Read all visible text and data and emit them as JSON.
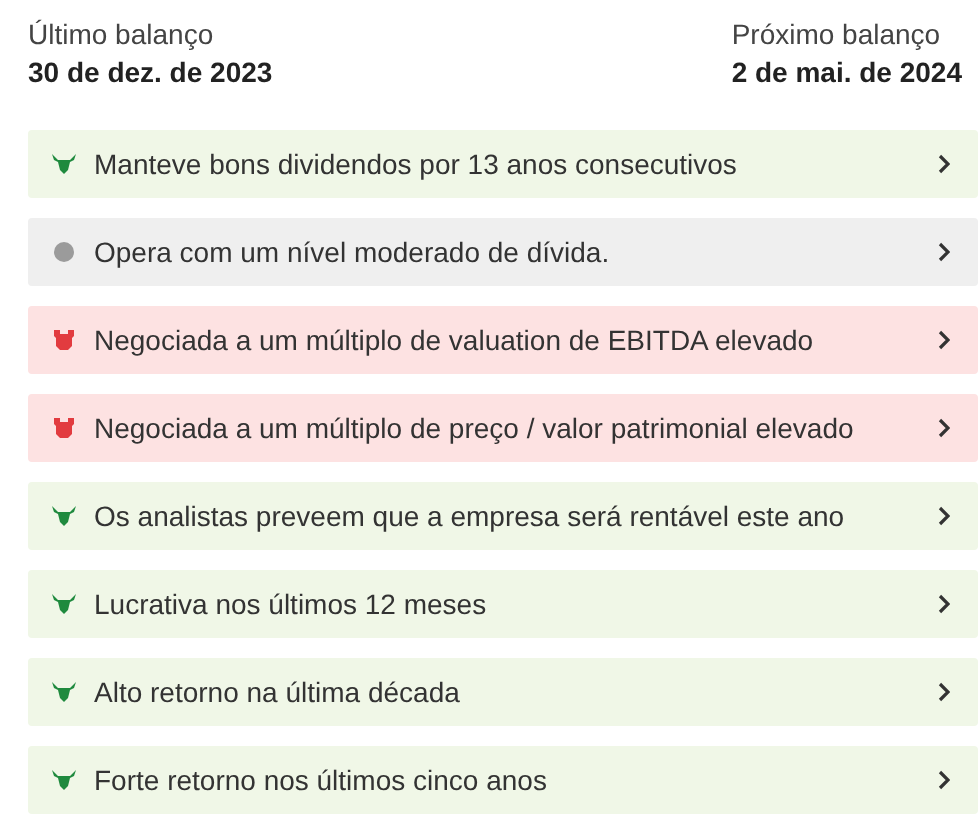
{
  "last_report": {
    "label": "Último balanço",
    "date": "30 de dez. de 2023"
  },
  "next_report": {
    "label": "Próximo balanço",
    "date": "2 de mai. de 2024"
  },
  "insights": [
    {
      "kind": "bull",
      "text": "Manteve bons dividendos por 13 anos consecutivos"
    },
    {
      "kind": "neutral",
      "text": "Opera com um nível moderado de dívida."
    },
    {
      "kind": "bear",
      "text": "Negociada a um múltiplo de valuation de EBITDA elevado"
    },
    {
      "kind": "bear",
      "text": "Negociada a um múltiplo de preço / valor patrimonial elevado"
    },
    {
      "kind": "bull",
      "text": "Os analistas preveem que a empresa será rentável este ano"
    },
    {
      "kind": "bull",
      "text": "Lucrativa nos últimos 12 meses"
    },
    {
      "kind": "bull",
      "text": "Alto retorno na última década"
    },
    {
      "kind": "bull",
      "text": "Forte retorno nos últimos cinco anos"
    }
  ]
}
